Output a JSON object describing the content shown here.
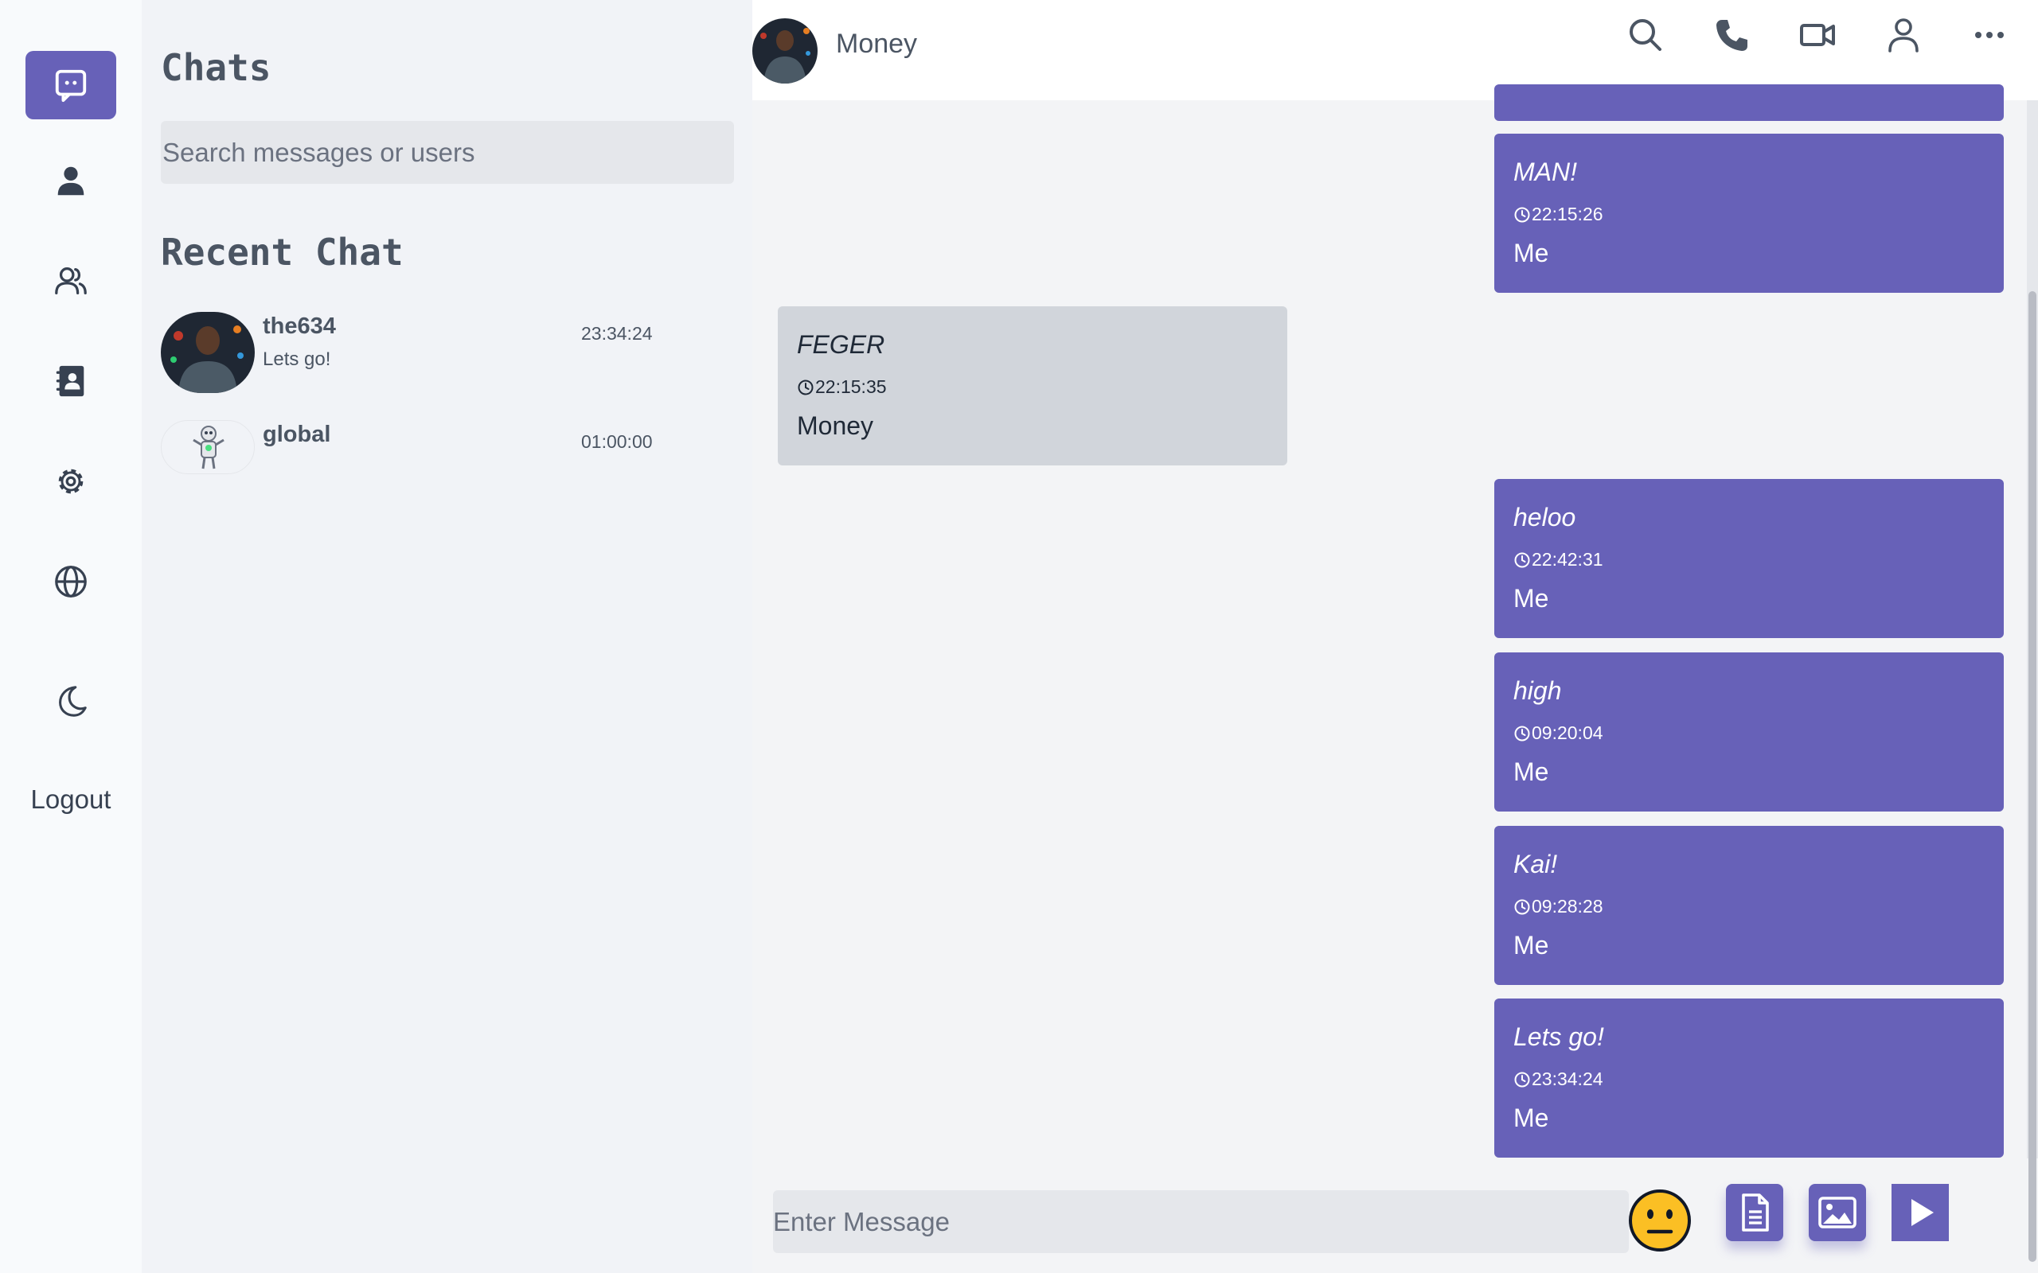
{
  "sidebar": {
    "nav": [
      "chat-icon",
      "user-icon",
      "users-icon",
      "contacts-icon",
      "settings-icon",
      "globe-icon",
      "moon-icon"
    ],
    "logout_label": "Logout"
  },
  "chats_panel": {
    "title": "Chats",
    "search_placeholder": "Search messages or users",
    "recent_title": "Recent Chat",
    "items": [
      {
        "name": "the634",
        "preview": "Lets go!",
        "time": "23:34:24",
        "avatar": "person-photo"
      },
      {
        "name": "global",
        "preview": "",
        "time": "01:00:00",
        "avatar": "robot-icon"
      }
    ]
  },
  "conversation": {
    "contact_name": "Money",
    "header_icons": [
      "search-icon",
      "phone-icon",
      "video-icon",
      "profile-icon",
      "more-icon"
    ],
    "messages": [
      {
        "text": "MAN!",
        "time": "22:15:26",
        "sender": "Me",
        "direction": "out"
      },
      {
        "text": "FEGER",
        "time": "22:15:35",
        "sender": "Money",
        "direction": "in"
      },
      {
        "text": "heloo",
        "time": "22:42:31",
        "sender": "Me",
        "direction": "out"
      },
      {
        "text": "high",
        "time": "09:20:04",
        "sender": "Me",
        "direction": "out"
      },
      {
        "text": "Kai!",
        "time": "09:28:28",
        "sender": "Me",
        "direction": "out"
      },
      {
        "text": "Lets go!",
        "time": "23:34:24",
        "sender": "Me",
        "direction": "out"
      }
    ],
    "composer_placeholder": "Enter Message"
  },
  "colors": {
    "accent": "#6761b8",
    "incoming_bubble": "#d1d5db",
    "emoji_face": "#fbbf24"
  }
}
